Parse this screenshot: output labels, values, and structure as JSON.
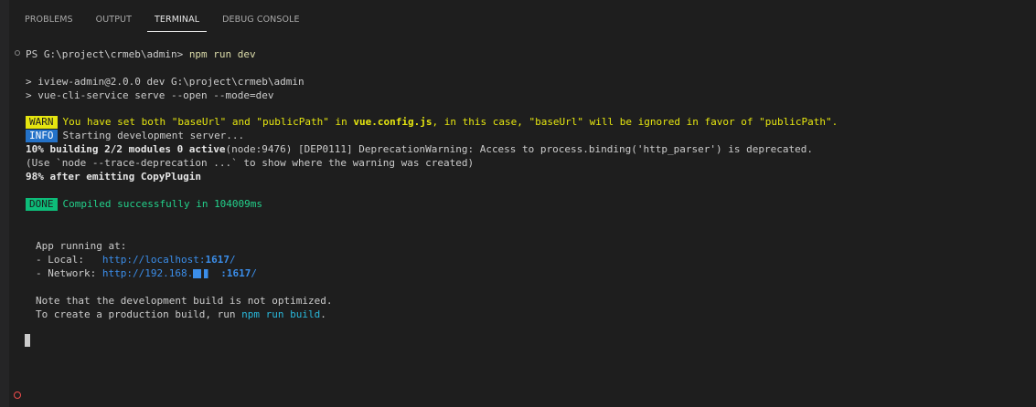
{
  "tabs": [
    {
      "label": "PROBLEMS"
    },
    {
      "label": "OUTPUT"
    },
    {
      "label": "TERMINAL"
    },
    {
      "label": "DEBUG CONSOLE"
    }
  ],
  "active_tab": "TERMINAL",
  "terminal": {
    "prompt": "PS G:\\project\\crmeb\\admin> ",
    "command": "npm run dev",
    "script_line_1": "> iview-admin@2.0.0 dev G:\\project\\crmeb\\admin",
    "script_line_2": "> vue-cli-service serve --open --mode=dev",
    "warn_badge": "WARN",
    "warn_text_1": "You have set both \"baseUrl\" and \"publicPath\" in ",
    "warn_file": "vue.config.js",
    "warn_text_2": ", in this case, \"baseUrl\" will be ignored in favor of \"publicPath\".",
    "info_badge": "INFO",
    "info_text": "Starting development server...",
    "build_progress": "10% building 2/2 modules 0 active",
    "deprecation_text": "(node:9476) [DEP0111] DeprecationWarning: Access to process.binding('http_parser') is deprecated.",
    "trace_hint": "(Use `node --trace-deprecation ...` to show where the warning was created)",
    "emit_line": "98% after emitting CopyPlugin",
    "done_badge": "DONE",
    "done_text": "Compiled successfully in 104009ms",
    "app_running": "App running at:",
    "local_label": "- Local:   ",
    "local_url_prefix": "http://localhost:",
    "local_port": "1617",
    "local_url_suffix": "/",
    "network_label": "- Network: ",
    "network_url_prefix": "http://192.168.",
    "network_port": "1617",
    "network_url_suffix": "/",
    "note_line": "Note that the development build is not optimized.",
    "prod_line_prefix": "To create a production build, run ",
    "prod_command": "npm run build",
    "prod_line_suffix": "."
  },
  "colors": {
    "background": "#1e1e1e",
    "warn": "#e5e510",
    "info": "#2472c8",
    "done": "#0dbc79",
    "link": "#3b8eea"
  }
}
